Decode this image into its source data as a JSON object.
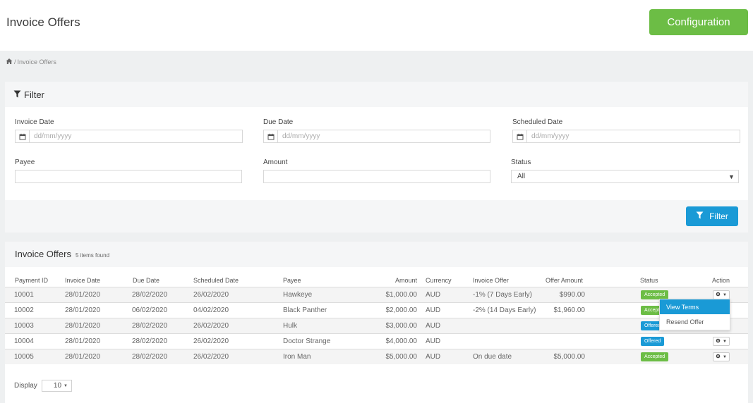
{
  "header": {
    "title": "Invoice Offers",
    "config_label": "Configuration"
  },
  "breadcrumb": {
    "separator": "/",
    "current": "Invoice Offers"
  },
  "filter": {
    "title": "Filter",
    "invoice_date": {
      "label": "Invoice Date",
      "placeholder": "dd/mm/yyyy"
    },
    "due_date": {
      "label": "Due Date",
      "placeholder": "dd/mm/yyyy"
    },
    "scheduled_date": {
      "label": "Scheduled Date",
      "placeholder": "dd/mm/yyyy"
    },
    "payee": {
      "label": "Payee",
      "value": ""
    },
    "amount": {
      "label": "Amount",
      "value": ""
    },
    "status": {
      "label": "Status",
      "value": "All"
    },
    "button_label": "Filter"
  },
  "table": {
    "title": "Invoice Offers",
    "count": "5 items found",
    "columns": [
      "Payment ID",
      "Invoice Date",
      "Due Date",
      "Scheduled Date",
      "Payee",
      "Amount",
      "Currency",
      "Invoice Offer",
      "Offer Amount",
      "Status",
      "Action"
    ],
    "rows": [
      {
        "payment_id": "10001",
        "invoice_date": "28/01/2020",
        "due_date": "28/02/2020",
        "scheduled_date": "26/02/2020",
        "payee": "Hawkeye",
        "amount": "$1,000.00",
        "currency": "AUD",
        "invoice_offer": "-1% (7 Days Early)",
        "offer_amount": "$990.00",
        "status": "Accepted"
      },
      {
        "payment_id": "10002",
        "invoice_date": "28/01/2020",
        "due_date": "06/02/2020",
        "scheduled_date": "04/02/2020",
        "payee": "Black Panther",
        "amount": "$2,000.00",
        "currency": "AUD",
        "invoice_offer": "-2% (14 Days Early)",
        "offer_amount": "$1,960.00",
        "status": "Accepted"
      },
      {
        "payment_id": "10003",
        "invoice_date": "28/01/2020",
        "due_date": "28/02/2020",
        "scheduled_date": "26/02/2020",
        "payee": "Hulk",
        "amount": "$3,000.00",
        "currency": "AUD",
        "invoice_offer": "",
        "offer_amount": "",
        "status": "Offered"
      },
      {
        "payment_id": "10004",
        "invoice_date": "28/01/2020",
        "due_date": "28/02/2020",
        "scheduled_date": "26/02/2020",
        "payee": "Doctor Strange",
        "amount": "$4,000.00",
        "currency": "AUD",
        "invoice_offer": "",
        "offer_amount": "",
        "status": "Offered"
      },
      {
        "payment_id": "10005",
        "invoice_date": "28/01/2020",
        "due_date": "28/02/2020",
        "scheduled_date": "26/02/2020",
        "payee": "Iron Man",
        "amount": "$5,000.00",
        "currency": "AUD",
        "invoice_offer": "On due date",
        "offer_amount": "$5,000.00",
        "status": "Accepted"
      }
    ],
    "action_menu": {
      "view_terms": "View Terms",
      "resend_offer": "Resend Offer"
    },
    "display": {
      "label": "Display",
      "value": "10"
    }
  },
  "colors": {
    "accent_green": "#6cbd45",
    "accent_blue": "#1a9ad6"
  },
  "icons": {
    "home": "home-icon",
    "filter": "filter-icon",
    "calendar": "calendar-icon",
    "gear": "gear-icon",
    "caret": "caret-down-icon"
  }
}
